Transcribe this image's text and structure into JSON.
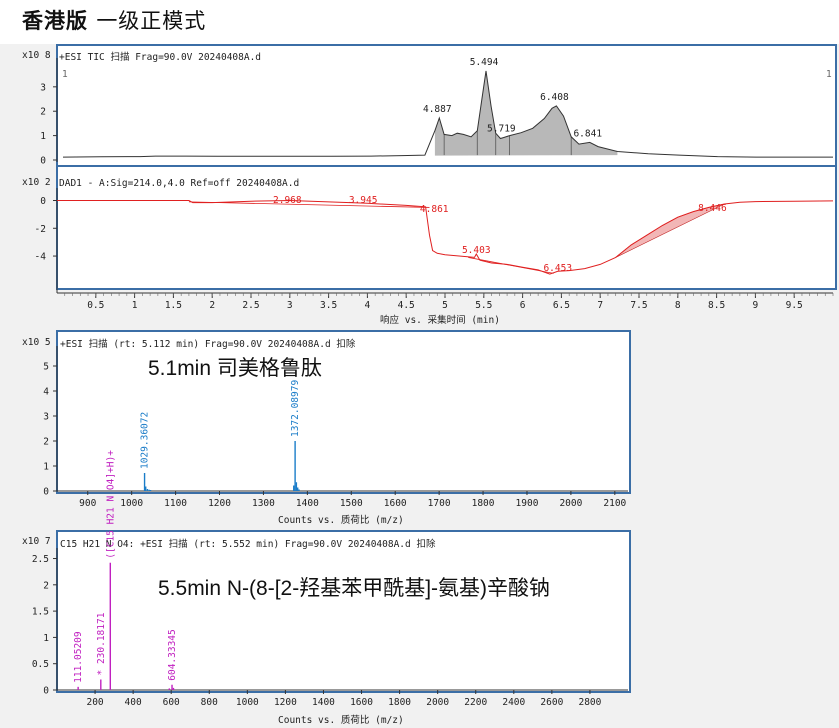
{
  "title": {
    "main": "香港版",
    "sub": "一级正模式"
  },
  "tic": {
    "header": "+ESI TIC 扫描 Frag=90.0V 20240408A.d",
    "magnitude": "x10 8",
    "corner_left": "1",
    "corner_right": "1",
    "chart_data": {
      "type": "line",
      "ylim": [
        0,
        4.1
      ],
      "xlim": [
        0,
        10
      ],
      "yticks": [
        "0",
        "1",
        "2",
        "3"
      ],
      "points": [
        [
          0,
          0.12
        ],
        [
          0.5,
          0.13
        ],
        [
          1,
          0.14
        ],
        [
          1.2,
          0.16
        ],
        [
          1.6,
          0.16
        ],
        [
          2,
          0.15
        ],
        [
          3,
          0.15
        ],
        [
          3.5,
          0.15
        ],
        [
          4,
          0.16
        ],
        [
          4.4,
          0.18
        ],
        [
          4.7,
          0.2
        ],
        [
          4.83,
          1.2
        ],
        [
          4.887,
          1.72
        ],
        [
          4.95,
          1.05
        ],
        [
          5.05,
          1.0
        ],
        [
          5.12,
          1.1
        ],
        [
          5.2,
          1.05
        ],
        [
          5.3,
          0.95
        ],
        [
          5.38,
          1.2
        ],
        [
          5.44,
          2.5
        ],
        [
          5.494,
          3.65
        ],
        [
          5.56,
          2.2
        ],
        [
          5.62,
          1.1
        ],
        [
          5.68,
          0.88
        ],
        [
          5.719,
          0.92
        ],
        [
          5.8,
          1.0
        ],
        [
          5.95,
          1.12
        ],
        [
          6.1,
          1.3
        ],
        [
          6.25,
          1.7
        ],
        [
          6.35,
          2.12
        ],
        [
          6.408,
          2.22
        ],
        [
          6.5,
          1.8
        ],
        [
          6.6,
          0.95
        ],
        [
          6.7,
          0.65
        ],
        [
          6.841,
          0.72
        ],
        [
          6.95,
          0.55
        ],
        [
          7.2,
          0.35
        ],
        [
          7.6,
          0.26
        ],
        [
          8,
          0.2
        ],
        [
          8.5,
          0.14
        ],
        [
          9,
          0.12
        ],
        [
          9.5,
          0.12
        ],
        [
          10,
          0.12
        ]
      ],
      "peaks": [
        {
          "label": "4.887",
          "x": 4.887,
          "y": 1.72
        },
        {
          "label": "5.494",
          "x": 5.494,
          "y": 3.65
        },
        {
          "label": "5.719",
          "x": 5.719,
          "y": 0.92
        },
        {
          "label": "6.408",
          "x": 6.408,
          "y": 2.22
        },
        {
          "label": "6.841",
          "x": 6.841,
          "y": 0.72
        }
      ]
    }
  },
  "dad": {
    "header": "DAD1 - A:Sig=214.0,4.0 Ref=off 20240408A.d",
    "magnitude": "x10 2",
    "xlabel": "响应 vs. 采集时间 (min)",
    "chart_data": {
      "type": "line",
      "xlim": [
        0,
        10
      ],
      "ylim": [
        -6.3,
        0.9
      ],
      "yticks": [
        "0",
        "-2",
        "-4"
      ],
      "xticks": [
        "0.5",
        "1",
        "1.5",
        "2",
        "2.5",
        "3",
        "3.5",
        "4",
        "4.5",
        "5",
        "5.5",
        "6",
        "6.5",
        "7",
        "7.5",
        "8",
        "8.5",
        "9",
        "9.5"
      ],
      "points": [
        [
          0,
          0
        ],
        [
          1,
          0
        ],
        [
          1.7,
          0
        ],
        [
          1.75,
          -0.15
        ],
        [
          2,
          -0.15
        ],
        [
          2.5,
          -0.05
        ],
        [
          3,
          0
        ],
        [
          3.5,
          -0.1
        ],
        [
          4,
          -0.2
        ],
        [
          4.5,
          -0.35
        ],
        [
          4.75,
          -0.45
        ],
        [
          4.8,
          -2.5
        ],
        [
          4.84,
          -3.6
        ],
        [
          4.9,
          -3.8
        ],
        [
          5.0,
          -3.9
        ],
        [
          5.2,
          -4.0
        ],
        [
          5.38,
          -4.1
        ],
        [
          5.403,
          -3.85
        ],
        [
          5.45,
          -4.3
        ],
        [
          5.6,
          -4.5
        ],
        [
          5.8,
          -4.6
        ],
        [
          6.0,
          -4.8
        ],
        [
          6.2,
          -5.0
        ],
        [
          6.35,
          -5.3
        ],
        [
          6.453,
          -5.1
        ],
        [
          6.6,
          -5.05
        ],
        [
          6.8,
          -4.9
        ],
        [
          7.0,
          -4.6
        ],
        [
          7.2,
          -4.1
        ],
        [
          7.4,
          -3.2
        ],
        [
          7.6,
          -2.5
        ],
        [
          7.8,
          -1.8
        ],
        [
          8.0,
          -1.2
        ],
        [
          8.2,
          -0.8
        ],
        [
          8.4,
          -0.5
        ],
        [
          8.6,
          -0.25
        ],
        [
          8.8,
          -0.12
        ],
        [
          9,
          -0.08
        ],
        [
          9.5,
          -0.05
        ],
        [
          10,
          -0.03
        ]
      ],
      "labels": [
        {
          "label": "2.968",
          "x": 2.968,
          "y": 0.12
        },
        {
          "label": "3.945",
          "x": 3.945,
          "y": 0.1
        },
        {
          "label": "4.861",
          "x": 4.861,
          "y": -0.55
        },
        {
          "label": "5.403",
          "x": 5.403,
          "y": -3.5
        },
        {
          "label": "6.453",
          "x": 6.453,
          "y": -4.8
        },
        {
          "label": "8.446",
          "x": 8.446,
          "y": -0.45
        }
      ]
    }
  },
  "ms1": {
    "header": "+ESI 扫描 (rt: 5.112 min) Frag=90.0V 20240408A.d  扣除",
    "magnitude": "x10 5",
    "annotation": "5.1min 司美格鲁肽",
    "xlabel": "Counts vs. 质荷比 (m/z)",
    "chart_data": {
      "type": "bar",
      "xlim": [
        830,
        2130
      ],
      "ylim": [
        0,
        5.8
      ],
      "yticks": [
        "0",
        "1",
        "2",
        "3",
        "4",
        "5"
      ],
      "xticks": [
        "900",
        "1000",
        "1100",
        "1200",
        "1300",
        "1400",
        "1500",
        "1600",
        "1700",
        "1800",
        "1900",
        "2000",
        "2100"
      ],
      "peaks": [
        {
          "mz": 1029.36072,
          "label": "1029.36072",
          "intensity": 0.72
        },
        {
          "mz": 1032,
          "intensity": 0.18
        },
        {
          "mz": 1036,
          "intensity": 0.08
        },
        {
          "mz": 1040,
          "intensity": 0.05
        },
        {
          "mz": 1043,
          "intensity": 0.04
        },
        {
          "mz": 1372.08979,
          "label": "1372.08979",
          "intensity": 2.0
        },
        {
          "mz": 1369,
          "intensity": 0.22
        },
        {
          "mz": 1375,
          "intensity": 0.35
        },
        {
          "mz": 1378,
          "intensity": 0.14
        },
        {
          "mz": 1381,
          "intensity": 0.06
        }
      ]
    }
  },
  "ms2": {
    "header": "C15 H21 N O4: +ESI 扫描 (rt: 5.552 min) Frag=90.0V 20240408A.d  扣除",
    "magnitude": "x10 7",
    "annotation": "5.5min N-(8-[2-羟基苯甲酰基]-氨基)辛酸钠",
    "xlabel": "Counts vs. 质荷比 (m/z)",
    "chart_data": {
      "type": "bar",
      "xlim": [
        0,
        3000
      ],
      "ylim": [
        0,
        2.7
      ],
      "yticks": [
        "0",
        "0.5",
        "1",
        "1.5",
        "2",
        "2.5"
      ],
      "xticks": [
        "200",
        "400",
        "600",
        "800",
        "1000",
        "1200",
        "1400",
        "1600",
        "1800",
        "2000",
        "2200",
        "2400",
        "2600",
        "2800"
      ],
      "peaks": [
        {
          "mz": 111.05209,
          "label": "111.05209",
          "intensity": 0.06
        },
        {
          "mz": 230.18171,
          "label": "* 230.18171",
          "intensity": 0.2
        },
        {
          "mz": 280.0,
          "label": "([C15 H21 N O4]+H)+",
          "intensity": 2.42
        },
        {
          "mz": 604.33345,
          "label": "604.33345",
          "intensity": 0.1
        },
        {
          "mz": 612,
          "intensity": 0.04
        },
        {
          "mz": 590,
          "intensity": 0.03
        }
      ]
    }
  },
  "colors": {
    "tic": "#333333",
    "dad": "#e02020",
    "ms1": "#1a7cc8",
    "ms2": "#c020c0",
    "border": "#3b6ea6"
  }
}
